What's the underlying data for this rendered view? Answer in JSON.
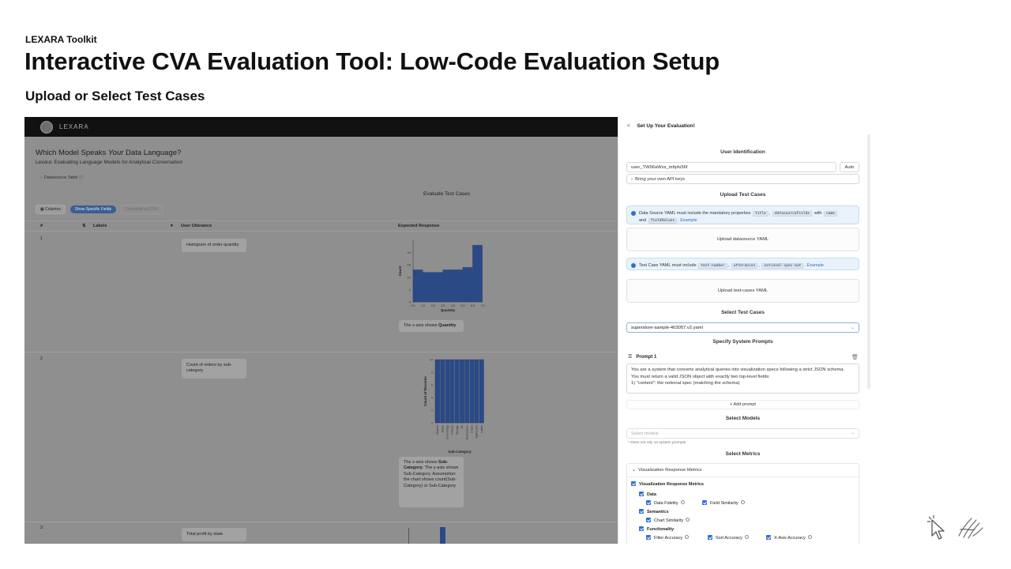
{
  "slide": {
    "kicker": "LEXARA Toolkit",
    "title": "Interactive CVA Evaluation Tool: Low-Code Evaluation Setup",
    "subtitle": "Upload or Select Test Cases"
  },
  "app": {
    "brand": "LEXARA",
    "heading_pre": "Which Model Speaks ",
    "heading_em": "Your",
    "heading_post": " Data Language?",
    "subheading": "Lexara: Evaluating Language Models for Analytical Conversation",
    "datasource_toggle": "Datasource Table",
    "eval_title": "Evaluate Test Cases",
    "toolbar": {
      "columns": "Columns",
      "toggle": "Show Specific Fields",
      "download": "Download as CSV"
    },
    "table_headers": {
      "num": "#",
      "labels": "Labels",
      "utterance": "User Utterance",
      "expected": "Expected Response"
    },
    "rows": [
      {
        "num": "1",
        "utterance": "Histogram of order quantity",
        "note_pre": "The x-axis shows ",
        "note_bold": "Quantity"
      },
      {
        "num": "2",
        "utterance": "Count of orders by sub-category",
        "note_pre": "The x-axis shows ",
        "note_bold": "Sub-Category",
        "note_extra": ". The y-axis shows Sub-Category. Assumption: the chart shows count(Sub-Category) or Sub-Category"
      },
      {
        "num": "3",
        "utterance": "Total profit by state"
      }
    ]
  },
  "chart_data": [
    {
      "type": "bar",
      "title": "",
      "xlabel": "Quantity",
      "ylabel": "Count",
      "x": [
        "0.0",
        "1.0",
        "2.0",
        "3.0",
        "4.0",
        "5.0",
        "6.0",
        "7.0"
      ],
      "values": [
        13,
        12,
        12,
        13,
        13,
        14,
        23
      ],
      "yticks": [
        "0",
        "5",
        "10",
        "15",
        "20"
      ],
      "ylim": [
        0,
        25
      ]
    },
    {
      "type": "bar",
      "title": "",
      "xlabel": "Sub-Category",
      "ylabel": "Count of Records",
      "categories": [
        "Binders",
        "Paper",
        "Furnishings",
        "Phones",
        "Storage",
        "Art",
        "Accessories",
        "Chairs",
        "Appliances",
        "Labels"
      ],
      "values": [
        10,
        10,
        10,
        10,
        10,
        10,
        10,
        10,
        10,
        10
      ],
      "yticks": [
        "0",
        "2",
        "4",
        "6",
        "8",
        "10"
      ],
      "ylim": [
        0,
        10
      ]
    }
  ],
  "panel": {
    "title": "Set Up Your Evaluation!",
    "user_identification": "User Identification",
    "user_id": "user_TW96aWxs_mfq4s56f",
    "auto_button": "Auto",
    "api_keys": "Bring your own API keys",
    "upload_test_cases": "Upload Test Cases",
    "info1_pre": "Data Source YAML must include the mandatory properties",
    "info1_code1": "title",
    "info1_code2": "datasourceFields",
    "info1_mid": "with",
    "info1_code3": "name",
    "info1_and": "and",
    "info1_code4": "fieldValues",
    "info1_link": "Example",
    "upload_datasource": "Upload datasource YAML",
    "info2_pre": "Test Case YAML must include",
    "info2_code1": "test-number",
    "info2_code2": "utterances",
    "info2_code3": "notional-spec-out",
    "info2_link": "Example",
    "upload_testcases": "Upload test-cases YAML",
    "select_test_cases": "Select Test Cases",
    "selected_file": "superstore-sample-403057.v2.yaml",
    "specify_prompts": "Specify System Prompts",
    "prompt_name": "Prompt 1",
    "prompt_lines": [
      "You are a system that converts analytical queries into visualization specs following a strict JSON schema.",
      "You must return a valid JSON object with exactly two top-level fields:",
      "1) \"content\": the notional spec (matching the schema)"
    ],
    "add_prompt": "+ Add prompt",
    "select_models": "Select Models",
    "models_placeholder": "Select models",
    "models_note": "* Does not rely on system prompts",
    "select_metrics": "Select Metrics",
    "metrics_group": "Visualization Response Metrics",
    "metrics_all": "Visualization Response Metrics",
    "metric_data": "Data",
    "metric_data_fidelity": "Data Fidelity",
    "metric_field_similarity": "Field Similarity",
    "metric_semantics": "Semantics",
    "metric_chart_similarity": "Chart Similarity",
    "metric_functionality": "Functionality",
    "metric_filter_accuracy": "Filter Accuracy",
    "metric_sort_accuracy": "Sort Accuracy",
    "metric_xaxis_accuracy": "X-Axis Accuracy"
  },
  "colors": {
    "accent": "#2f6fd0",
    "bar": "#2a4a87",
    "info_bg": "#e9f2fb"
  },
  "icons": [
    "close-icon",
    "chevron-right-icon",
    "chevron-down-icon",
    "drag-handle-icon",
    "trash-icon",
    "info-icon",
    "pointer-cursor-icon",
    "hand-drawing-icon"
  ]
}
